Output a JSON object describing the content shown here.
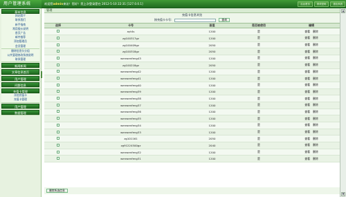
{
  "header": {
    "logo": "用户管理系统",
    "welcome_prefix": "欢迎您",
    "username": "admin",
    "welcome_suffix": "来访！您好！您上次登录是在",
    "last_login": "2012-5-10 22:31 [127.0.0.1]",
    "buttons": [
      "后台首页",
      "修改密码",
      "退出系统"
    ]
  },
  "sidebar": {
    "groups": [
      {
        "title": "基本信息",
        "items": [
          "网站简介",
          "联系我们",
          "新手指南",
          "常用报价说明",
          "首页广告",
          "邮件推荐",
          "添加管理员",
          "会员管理"
        ]
      },
      {
        "title": "",
        "items": [
          "删除信息头分组",
          "公共管理修改系统说明",
          "联系管理"
        ]
      },
      {
        "title": "新闻新闻",
        "items": []
      },
      {
        "title": "文章信息首页",
        "items": []
      },
      {
        "title": "用户管理",
        "items": []
      },
      {
        "title": "问题信息",
        "items": []
      },
      {
        "title": "充值卡管理",
        "items": [
          "添加充值卡",
          "充值卡管理"
        ]
      },
      {
        "title": "用户管理",
        "items": []
      },
      {
        "title": "数据管理",
        "items": []
      }
    ]
  },
  "main": {
    "subhead": "管理",
    "title": "充值卡信息浏览",
    "search_label": "按充值卡卡号:",
    "search_value": "",
    "search_button": "查询",
    "columns": [
      "选择",
      "卡号",
      "面值",
      "是否被使用",
      "编辑"
    ],
    "rows": [
      {
        "card": "ayt4s",
        "value": "1200",
        "used": "是"
      },
      {
        "card": "zg100317gz",
        "value": "1200",
        "used": "是"
      },
      {
        "card": "zg100409gz",
        "value": "2050",
        "used": "是"
      },
      {
        "card": "zg100318gz",
        "value": "2050",
        "used": "是"
      },
      {
        "card": "wenwenfeng43",
        "value": "1200",
        "used": "是"
      },
      {
        "card": "zg100218gz",
        "value": "2050",
        "used": "是"
      },
      {
        "card": "wenwenfeng42",
        "value": "1200",
        "used": "是"
      },
      {
        "card": "wenwenfeng41",
        "value": "1200",
        "used": "是"
      },
      {
        "card": "wenwenfeng40",
        "value": "1200",
        "used": "是"
      },
      {
        "card": "wenwenfeng39",
        "value": "1200",
        "used": "是"
      },
      {
        "card": "wenwenfeng38",
        "value": "1200",
        "used": "是"
      },
      {
        "card": "wenwenfeng37",
        "value": "1200",
        "used": "是"
      },
      {
        "card": "wenwenfeng36",
        "value": "1200",
        "used": "是"
      },
      {
        "card": "wenwenfeng35",
        "value": "1200",
        "used": "是"
      },
      {
        "card": "wenwenfeng34",
        "value": "1200",
        "used": "是"
      },
      {
        "card": "wenwenfeng33",
        "value": "1200",
        "used": "是"
      },
      {
        "card": "zg101161",
        "value": "2050",
        "used": "是"
      },
      {
        "card": "zg91224500gz",
        "value": "2040",
        "used": "是"
      },
      {
        "card": "wenwenfeng32",
        "value": "1200",
        "used": "是"
      },
      {
        "card": "wenwenfeng31",
        "value": "1200",
        "used": "是"
      }
    ],
    "edit_links": [
      "查看",
      "删除"
    ],
    "delete_selected": "删除所选信息"
  }
}
